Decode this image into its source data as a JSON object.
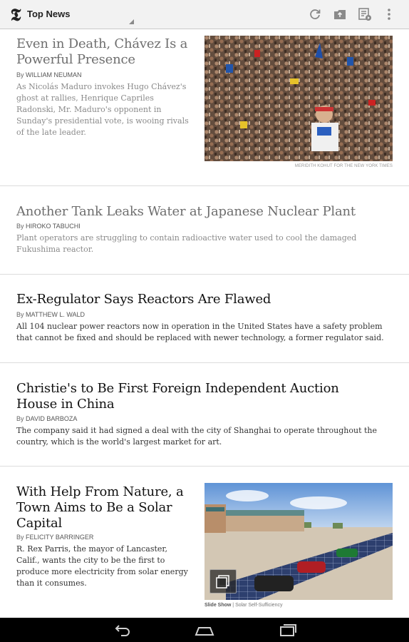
{
  "actionbar": {
    "logo_glyph": "𝕿",
    "section_title": "Top News",
    "icons": [
      "refresh-icon",
      "share-icon",
      "saved-articles-icon",
      "overflow-menu-icon"
    ]
  },
  "articles": [
    {
      "headline": "Even in Death, Chávez Is a Powerful Presence",
      "by": "By ",
      "author": "WILLIAM NEUMAN",
      "summary": "As Nicolás Maduro invokes Hugo Chávez's ghost at rallies, Henrique Capriles Radonski, Mr. Maduro's opponent in Sunday's presidential vote, is wooing rivals of the late leader.",
      "photo_credit": "MERIDITH KOHUT FOR THE NEW YORK TIMES",
      "read": true
    },
    {
      "headline": "Another Tank Leaks Water at Japanese Nuclear Plant",
      "by": "By ",
      "author": "HIROKO TABUCHI",
      "summary": "Plant operators are struggling to contain radioactive water used to cool the damaged Fukushima reactor.",
      "read": true
    },
    {
      "headline": "Ex-Regulator Says Reactors Are Flawed",
      "by": "By ",
      "author": "MATTHEW L. WALD",
      "summary": "All 104 nuclear power reactors now in operation in the United States have a safety problem that cannot be fixed and should be replaced with newer technology, a former regulator said.",
      "read": false
    },
    {
      "headline": "Christie's to Be First Foreign Independent Auction House in China",
      "by": "By ",
      "author": "DAVID BARBOZA",
      "summary": "The company said it had signed a deal with the city of Shanghai to operate throughout the country, which is the world's largest market for art.",
      "read": false
    },
    {
      "headline": "With Help From Nature, a Town Aims to Be a Solar Capital",
      "by": "By ",
      "author": "FELICITY BARRINGER",
      "summary": "R. Rex Parris, the mayor of Lancaster, Calif., wants the city to be the first to produce more electricity from solar energy than it consumes.",
      "caption_strong": "Slide Show",
      "caption_sep": " | ",
      "caption_text": "Solar Self-Sufficiency",
      "read": false
    }
  ],
  "navbar": {
    "icons": [
      "back-icon",
      "home-icon",
      "recent-apps-icon"
    ]
  },
  "colors": {
    "actionbar_bg": "#f2f2f2",
    "read_headline": "#6e6e6e",
    "unread_headline": "#111111",
    "navbar_bg": "#000000"
  }
}
